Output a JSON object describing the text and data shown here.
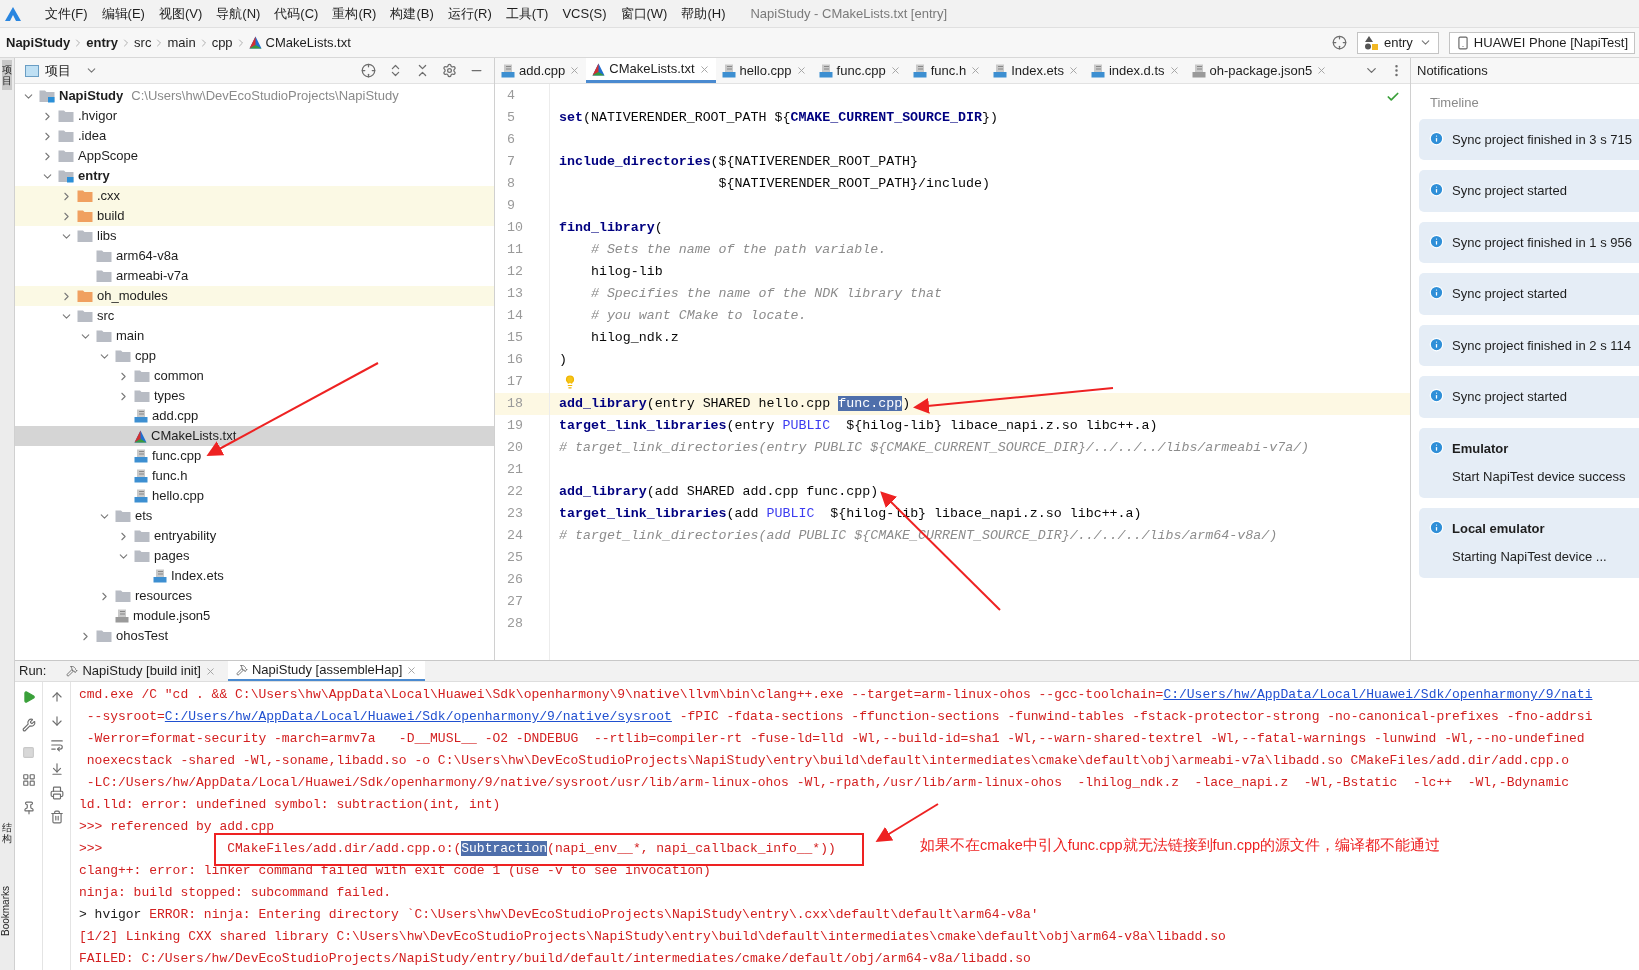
{
  "menu_bar": {
    "items": [
      "文件(F)",
      "编辑(E)",
      "视图(V)",
      "导航(N)",
      "代码(C)",
      "重构(R)",
      "构建(B)",
      "运行(R)",
      "工具(T)",
      "VCS(S)",
      "窗口(W)",
      "帮助(H)"
    ],
    "title": "NapiStudy - CMakeLists.txt [entry]"
  },
  "breadcrumb": [
    {
      "label": "NapiStudy",
      "bold": true,
      "kind": "plain"
    },
    {
      "label": "entry",
      "bold": true,
      "kind": "plain"
    },
    {
      "label": "src",
      "bold": false,
      "kind": "plain"
    },
    {
      "label": "main",
      "bold": false,
      "kind": "plain"
    },
    {
      "label": "cpp",
      "bold": false,
      "kind": "plain"
    },
    {
      "label": "CMakeLists.txt",
      "bold": false,
      "kind": "cmake"
    }
  ],
  "run_config": {
    "module": "entry",
    "device": "HUAWEI Phone [NapiTest]"
  },
  "side_strip": {
    "top": "项目",
    "middle": "结构",
    "bottom": "Bookmarks"
  },
  "project_panel": {
    "title": "项目",
    "tree": [
      {
        "name": "NapiStudy",
        "path": "C:\\Users\\hw\\DevEcoStudioProjects\\NapiStudy",
        "kind": "module",
        "bold": true,
        "expanded": true,
        "selected": false,
        "children": [
          {
            "name": ".hvigor",
            "kind": "folder",
            "bold": false,
            "expanded": false,
            "selected": false
          },
          {
            "name": ".idea",
            "kind": "folder",
            "bold": false,
            "expanded": false,
            "selected": false
          },
          {
            "name": "AppScope",
            "kind": "folder",
            "bold": false,
            "expanded": false,
            "selected": false
          },
          {
            "name": "entry",
            "kind": "module",
            "bold": true,
            "expanded": true,
            "selected": false,
            "children": [
              {
                "name": ".cxx",
                "kind": "excluded",
                "bold": false,
                "expanded": false,
                "selected": false
              },
              {
                "name": "build",
                "kind": "excluded",
                "bold": false,
                "expanded": false,
                "selected": false
              },
              {
                "name": "libs",
                "kind": "folder",
                "bold": false,
                "expanded": true,
                "selected": false,
                "children": [
                  {
                    "name": "arm64-v8a",
                    "kind": "folder",
                    "bold": false,
                    "selected": false
                  },
                  {
                    "name": "armeabi-v7a",
                    "kind": "folder",
                    "bold": false,
                    "selected": false
                  }
                ]
              },
              {
                "name": "oh_modules",
                "kind": "excluded",
                "bold": false,
                "expanded": false,
                "selected": false
              },
              {
                "name": "src",
                "kind": "folder",
                "bold": false,
                "expanded": true,
                "selected": false,
                "children": [
                  {
                    "name": "main",
                    "kind": "folder",
                    "bold": false,
                    "expanded": true,
                    "selected": false,
                    "children": [
                      {
                        "name": "cpp",
                        "kind": "folder",
                        "bold": false,
                        "expanded": true,
                        "selected": false,
                        "children": [
                          {
                            "name": "common",
                            "kind": "folder",
                            "bold": false,
                            "expanded": false,
                            "selected": false
                          },
                          {
                            "name": "types",
                            "kind": "folder",
                            "bold": false,
                            "expanded": false,
                            "selected": false
                          },
                          {
                            "name": "add.cpp",
                            "kind": "cpp",
                            "bold": false,
                            "selected": false
                          },
                          {
                            "name": "CMakeLists.txt",
                            "kind": "cmake",
                            "bold": false,
                            "selected": true
                          },
                          {
                            "name": "func.cpp",
                            "kind": "cpp",
                            "bold": false,
                            "selected": false
                          },
                          {
                            "name": "func.h",
                            "kind": "h",
                            "bold": false,
                            "selected": false
                          },
                          {
                            "name": "hello.cpp",
                            "kind": "cpp",
                            "bold": false,
                            "selected": false
                          }
                        ]
                      },
                      {
                        "name": "ets",
                        "kind": "folder",
                        "bold": false,
                        "expanded": true,
                        "selected": false,
                        "children": [
                          {
                            "name": "entryability",
                            "kind": "folder",
                            "bold": false,
                            "expanded": false,
                            "selected": false
                          },
                          {
                            "name": "pages",
                            "kind": "folder",
                            "bold": false,
                            "expanded": true,
                            "selected": false,
                            "children": [
                              {
                                "name": "Index.ets",
                                "kind": "ets",
                                "bold": false,
                                "selected": false
                              }
                            ]
                          }
                        ]
                      },
                      {
                        "name": "resources",
                        "kind": "folder",
                        "bold": false,
                        "expanded": false,
                        "selected": false
                      },
                      {
                        "name": "module.json5",
                        "kind": "json",
                        "bold": false,
                        "selected": false
                      }
                    ]
                  },
                  {
                    "name": "ohosTest",
                    "kind": "folder",
                    "bold": false,
                    "expanded": false,
                    "selected": false
                  }
                ]
              }
            ]
          }
        ]
      }
    ]
  },
  "editor": {
    "tabs": [
      {
        "label": "add.cpp",
        "kind": "cpp",
        "selected": false
      },
      {
        "label": "CMakeLists.txt",
        "kind": "cmake",
        "selected": true
      },
      {
        "label": "hello.cpp",
        "kind": "cpp",
        "selected": false
      },
      {
        "label": "func.cpp",
        "kind": "cpp",
        "selected": false
      },
      {
        "label": "func.h",
        "kind": "h",
        "selected": false
      },
      {
        "label": "Index.ets",
        "kind": "ets",
        "selected": false
      },
      {
        "label": "index.d.ts",
        "kind": "ts",
        "selected": false
      },
      {
        "label": "oh-package.json5",
        "kind": "json",
        "selected": false
      }
    ],
    "lines": [
      {
        "num": "4",
        "current": false
      },
      {
        "num": "5",
        "current": false,
        "segments": [
          {
            "kind": "fn",
            "text": "set"
          },
          {
            "kind": "plain",
            "text": "(NATIVERENDER_ROOT_PATH ${"
          },
          {
            "kind": "var",
            "text": "CMAKE_CURRENT_SOURCE_DIR"
          },
          {
            "kind": "plain",
            "text": "})"
          }
        ]
      },
      {
        "num": "6",
        "current": false
      },
      {
        "num": "7",
        "current": false,
        "segments": [
          {
            "kind": "fn",
            "text": "include_directories"
          },
          {
            "kind": "plain",
            "text": "(${NATIVERENDER_ROOT_PATH}"
          }
        ]
      },
      {
        "num": "8",
        "current": false,
        "segments": [
          {
            "kind": "plain",
            "text": "                    ${NATIVERENDER_ROOT_PATH}/include)"
          }
        ]
      },
      {
        "num": "9",
        "current": false
      },
      {
        "num": "10",
        "current": false,
        "segments": [
          {
            "kind": "fn",
            "text": "find_library"
          },
          {
            "kind": "plain",
            "text": "("
          }
        ]
      },
      {
        "num": "11",
        "current": false,
        "segments": [
          {
            "kind": "comment",
            "text": "    # Sets the name of the path variable."
          }
        ]
      },
      {
        "num": "12",
        "current": false,
        "segments": [
          {
            "kind": "plain",
            "text": "    hilog-lib"
          }
        ]
      },
      {
        "num": "13",
        "current": false,
        "segments": [
          {
            "kind": "comment",
            "text": "    # Specifies the name of the NDK library that"
          }
        ]
      },
      {
        "num": "14",
        "current": false,
        "segments": [
          {
            "kind": "comment",
            "text": "    # you want CMake to locate."
          }
        ]
      },
      {
        "num": "15",
        "current": false,
        "segments": [
          {
            "kind": "plain",
            "text": "    hilog_ndk.z"
          }
        ]
      },
      {
        "num": "16",
        "current": false,
        "segments": [
          {
            "kind": "plain",
            "text": ")"
          }
        ]
      },
      {
        "num": "17",
        "current": false,
        "bulb": true
      },
      {
        "num": "18",
        "current": true,
        "segments": [
          {
            "kind": "fn",
            "text": "add_library"
          },
          {
            "kind": "plain",
            "text": "(entry SHARED hello.cpp "
          },
          {
            "kind": "selection",
            "text": "func.cpp"
          },
          {
            "kind": "plain",
            "text": ")"
          }
        ]
      },
      {
        "num": "19",
        "current": false,
        "segments": [
          {
            "kind": "fn",
            "text": "target_link_libraries"
          },
          {
            "kind": "plain",
            "text": "(entry "
          },
          {
            "kind": "keyword",
            "text": "PUBLIC"
          },
          {
            "kind": "plain",
            "text": "  ${hilog-lib} libace_napi.z.so libc++.a)"
          }
        ]
      },
      {
        "num": "20",
        "current": false,
        "segments": [
          {
            "kind": "comment",
            "text": "# target_link_directories(entry PUBLIC ${CMAKE_CURRENT_SOURCE_DIR}/../../../libs/armeabi-v7a/)"
          }
        ]
      },
      {
        "num": "21",
        "current": false
      },
      {
        "num": "22",
        "current": false,
        "segments": [
          {
            "kind": "fn",
            "text": "add_library"
          },
          {
            "kind": "plain",
            "text": "(add SHARED add.cpp func.cpp)"
          }
        ]
      },
      {
        "num": "23",
        "current": false,
        "segments": [
          {
            "kind": "fn",
            "text": "target_link_libraries"
          },
          {
            "kind": "plain",
            "text": "(add "
          },
          {
            "kind": "keyword",
            "text": "PUBLIC"
          },
          {
            "kind": "plain",
            "text": "  ${hilog-lib} libace_napi.z.so libc++.a)"
          }
        ]
      },
      {
        "num": "24",
        "current": false,
        "segments": [
          {
            "kind": "comment",
            "text": "# target_link_directories(add PUBLIC ${CMAKE_CURRENT_SOURCE_DIR}/../../../libs/arm64-v8a/)"
          }
        ]
      },
      {
        "num": "25",
        "current": false
      },
      {
        "num": "26",
        "current": false
      },
      {
        "num": "27",
        "current": false
      },
      {
        "num": "28",
        "current": false
      }
    ]
  },
  "notifications": {
    "title": "Notifications",
    "section": "Timeline",
    "items": [
      {
        "text": "Sync project finished in 3 s 715"
      },
      {
        "text": "Sync project started"
      },
      {
        "text": "Sync project finished in 1 s 956"
      },
      {
        "text": "Sync project started"
      },
      {
        "text": "Sync project finished in 2 s 114"
      },
      {
        "text": "Sync project started"
      },
      {
        "title": "Emulator",
        "text": "Start NapiTest device success"
      },
      {
        "title": "Local emulator",
        "text": "Starting NapiTest device ..."
      }
    ]
  },
  "run_panel": {
    "label": "Run:",
    "tabs": [
      {
        "label": "NapiStudy [build init]",
        "selected": false
      },
      {
        "label": "NapiStudy [assembleHap]",
        "selected": true
      }
    ],
    "console": [
      [
        {
          "kind": "error",
          "text": "cmd.exe /C \"cd . && C:\\Users\\hw\\AppData\\Local\\Huawei\\Sdk\\openharmony\\9\\native\\llvm\\bin\\clang++.exe --target=arm-linux-ohos --gcc-toolchain="
        },
        {
          "kind": "link",
          "text": "C:/Users/hw/AppData/Local/Huawei/Sdk/openharmony/9/nati"
        }
      ],
      [
        {
          "kind": "error",
          "text": " --sysroot="
        },
        {
          "kind": "link",
          "text": "C:/Users/hw/AppData/Local/Huawei/Sdk/openharmony/9/native/sysroot"
        },
        {
          "kind": "error",
          "text": " -fPIC -fdata-sections -ffunction-sections -funwind-tables -fstack-protector-strong -no-canonical-prefixes -fno-addrsi"
        }
      ],
      [
        {
          "kind": "error",
          "text": " -Werror=format-security -march=armv7a   -D__MUSL__ -O2 -DNDEBUG  --rtlib=compiler-rt -fuse-ld=lld -Wl,--build-id=sha1 -Wl,--warn-shared-textrel -Wl,--fatal-warnings -lunwind -Wl,--no-undefined"
        }
      ],
      [
        {
          "kind": "error",
          "text": " noexecstack -shared -Wl,-soname,libadd.so -o C:\\Users\\hw\\DevEcoStudioProjects\\NapiStudy\\entry\\build\\default\\intermediates\\cmake\\default\\obj\\armeabi-v7a\\libadd.so CMakeFiles/add.dir/add.cpp.o"
        }
      ],
      [
        {
          "kind": "error",
          "text": " -LC:/Users/hw/AppData/Local/Huawei/Sdk/openharmony/9/native/sysroot/usr/lib/arm-linux-ohos -Wl,-rpath,/usr/lib/arm-linux-ohos  -lhilog_ndk.z  -lace_napi.z  -Wl,-Bstatic  -lc++  -Wl,-Bdynamic"
        }
      ],
      [
        {
          "kind": "error",
          "text": "ld.lld: error: undefined symbol: subtraction(int, int)"
        }
      ],
      [
        {
          "kind": "error",
          "text": ">>> referenced by add.cpp"
        }
      ],
      [
        {
          "kind": "error",
          "text": ">>>                CMakeFiles/add.dir/add.cpp.o:("
        },
        {
          "kind": "match",
          "text": "Subtraction"
        },
        {
          "kind": "error",
          "text": "(napi_env__*, napi_callback_info__*))"
        }
      ],
      [
        {
          "kind": "error",
          "text": "clang++: error: linker command failed with exit code 1 (use -v to see invocation)"
        }
      ],
      [
        {
          "kind": "error",
          "text": "ninja: build stopped: subcommand failed."
        }
      ],
      [
        {
          "kind": "plain",
          "text": "> hvigor "
        },
        {
          "kind": "error",
          "text": "ERROR: ninja: Entering directory `C:\\Users\\hw\\DevEcoStudioProjects\\NapiStudy\\entry\\.cxx\\default\\default\\arm64-v8a'"
        }
      ],
      [
        {
          "kind": "error",
          "text": "[1/2] Linking CXX shared library C:\\Users\\hw\\DevEcoStudioProjects\\NapiStudy\\entry\\build\\default\\intermediates\\cmake\\default\\obj\\arm64-v8a\\libadd.so"
        }
      ],
      [
        {
          "kind": "error",
          "text": "FAILED: C:/Users/hw/DevEcoStudioProjects/NapiStudy/entry/build/default/intermediates/cmake/default/obj/arm64-v8a/libadd.so"
        }
      ]
    ]
  },
  "annotation": {
    "text": "如果不在cmake中引入func.cpp就无法链接到fun.cpp的源文件，编译都不能通过"
  }
}
